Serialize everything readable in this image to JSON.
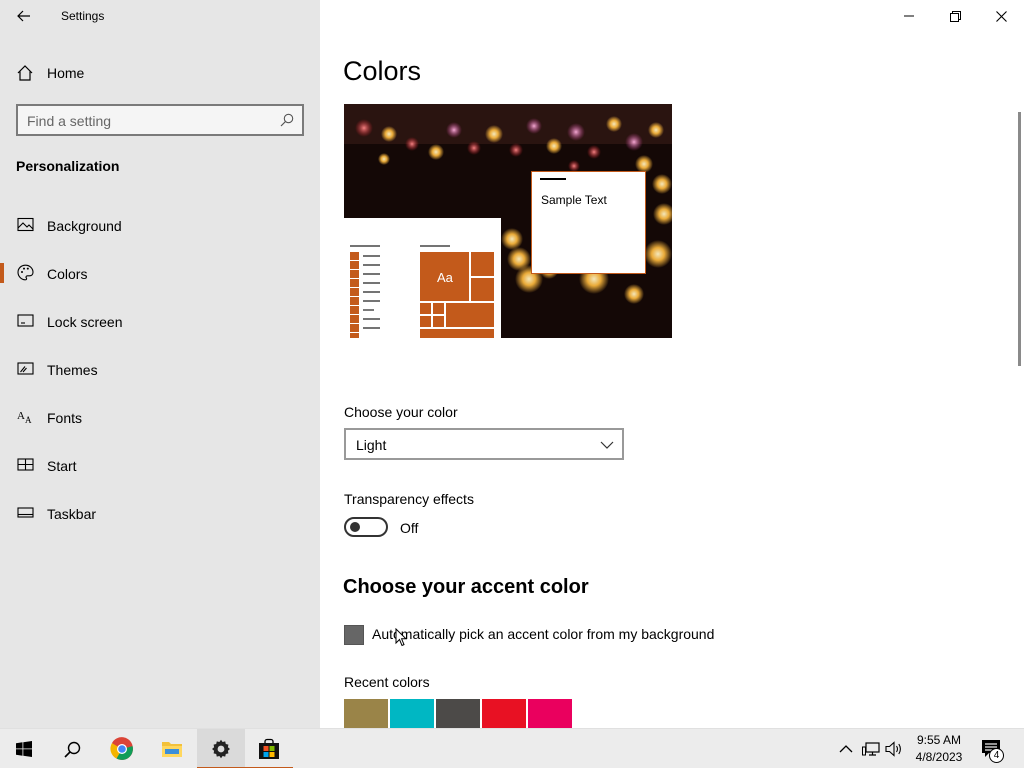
{
  "window": {
    "title": "Settings"
  },
  "sidebar": {
    "home_label": "Home",
    "search_placeholder": "Find a setting",
    "section_title": "Personalization",
    "items": [
      {
        "label": "Background",
        "icon": "image-icon"
      },
      {
        "label": "Colors",
        "icon": "palette-icon",
        "selected": true
      },
      {
        "label": "Lock screen",
        "icon": "lock-screen-icon"
      },
      {
        "label": "Themes",
        "icon": "themes-icon"
      },
      {
        "label": "Fonts",
        "icon": "fonts-icon"
      },
      {
        "label": "Start",
        "icon": "start-icon"
      },
      {
        "label": "Taskbar",
        "icon": "taskbar-icon"
      }
    ]
  },
  "main": {
    "title": "Colors",
    "preview": {
      "sample_text": "Sample Text",
      "tile_label": "Aa"
    },
    "choose_color": {
      "label": "Choose your color",
      "value": "Light"
    },
    "transparency": {
      "label": "Transparency effects",
      "state": "Off"
    },
    "accent": {
      "heading": "Choose your accent color",
      "auto_pick_label": "Automatically pick an accent color from my background",
      "recent_label": "Recent colors",
      "recent_colors": [
        "#9a8448",
        "#00b7c3",
        "#4c4a48",
        "#e81123",
        "#ea005e"
      ]
    }
  },
  "taskbar": {
    "apps": [
      "start-icon",
      "search-icon",
      "chrome-icon",
      "file-explorer-icon",
      "settings-icon",
      "store-icon"
    ],
    "time": "9:55 AM",
    "date": "4/8/2023",
    "notification_count": "4"
  },
  "colors": {
    "accent": "#c35a1b",
    "sidebar_bg": "#e6e6e6"
  }
}
